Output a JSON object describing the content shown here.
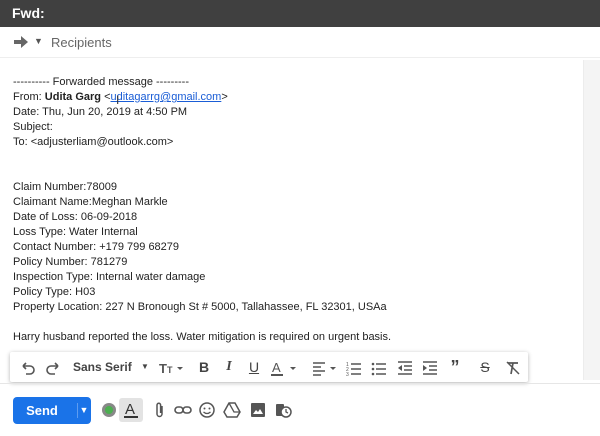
{
  "window": {
    "title": "Fwd:"
  },
  "recipients": {
    "label": "Recipients"
  },
  "body": {
    "header_line": "---------- Forwarded message ---------",
    "from_prefix": "From: ",
    "from_name": "Udita Garg",
    "from_lt": " <",
    "from_email": "uditagarrg@gmail.com",
    "from_gt": ">",
    "date": "Date: Thu, Jun 20, 2019 at 4:50 PM",
    "subject": "Subject:",
    "to": "To: <adjusterliam@outlook.com>",
    "lines": [
      "Claim Number:78009",
      "Claimant Name:Meghan Markle",
      "Date of Loss: 06-09-2018",
      "Loss Type: Water Internal",
      "Contact Number: +179 799 68279",
      "Policy Number: 781279",
      "Inspection Type: Internal water damage",
      "Policy Type: H03",
      "Property Location: 227 N Bronough St # 5000, Tallahassee, FL 32301, USAa"
    ],
    "note": "Harry husband reported the loss. Water mitigation is required on urgent basis."
  },
  "toolbar": {
    "font_family": "Sans Serif",
    "items": [
      "undo-icon",
      "redo-icon",
      "font-size-icon",
      "bold-icon",
      "italic-icon",
      "underline-icon",
      "text-color-icon",
      "align-icon",
      "numbered-list-icon",
      "bulleted-list-icon",
      "indent-less-icon",
      "indent-more-icon",
      "quote-icon",
      "strikethrough-icon",
      "remove-formatting-icon"
    ]
  },
  "bottom": {
    "send_label": "Send",
    "icons": [
      "formatting-icon",
      "attach-icon",
      "link-icon",
      "emoji-icon",
      "drive-icon",
      "photo-icon",
      "schedule-icon"
    ]
  },
  "colors": {
    "accent": "#1a73e8",
    "titlebar": "#404040",
    "link": "#1a5dd6"
  }
}
